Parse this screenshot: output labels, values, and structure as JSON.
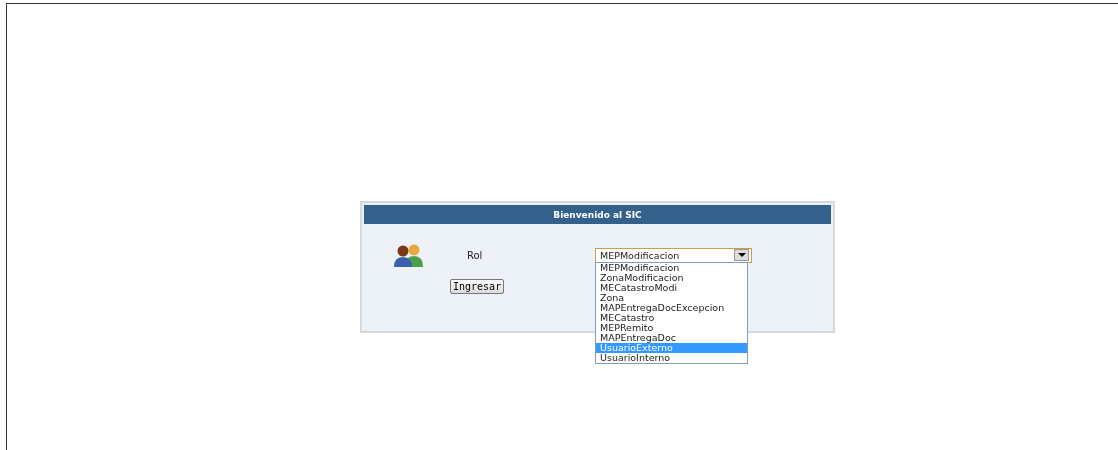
{
  "panel": {
    "title": "Bienvenido al SIC"
  },
  "role": {
    "label": "Rol",
    "value": "MEPModificacion",
    "expanded": true,
    "options": [
      {
        "label": "MEPModificacion",
        "highlighted": false
      },
      {
        "label": "ZonaModificacion",
        "highlighted": false
      },
      {
        "label": "MECatastroModi",
        "highlighted": false
      },
      {
        "label": "Zona",
        "highlighted": false
      },
      {
        "label": "MAPEntregaDocExcepcion",
        "highlighted": false
      },
      {
        "label": "MECatastro",
        "highlighted": false
      },
      {
        "label": "MEPRemito",
        "highlighted": false
      },
      {
        "label": "MAPEntregaDoc",
        "highlighted": false
      },
      {
        "label": "UsuarioExterno",
        "highlighted": true
      },
      {
        "label": "UsuarioInterno",
        "highlighted": false
      }
    ]
  },
  "buttons": [
    "Ingresar"
  ]
}
